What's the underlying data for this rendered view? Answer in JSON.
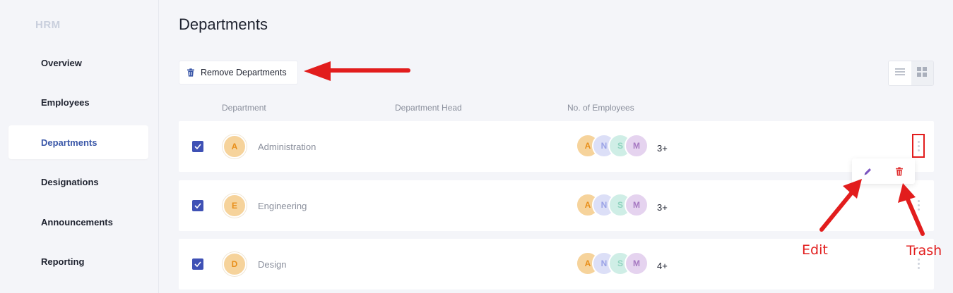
{
  "sidebar": {
    "brand": "HRM",
    "items": [
      {
        "label": "Overview"
      },
      {
        "label": "Employees"
      },
      {
        "label": "Departments",
        "active": true
      },
      {
        "label": "Designations"
      },
      {
        "label": "Announcements"
      },
      {
        "label": "Reporting"
      }
    ]
  },
  "main": {
    "title": "Departments",
    "remove_label": "Remove Departments",
    "columns": {
      "department": "Department",
      "head": "Department Head",
      "employees": "No. of Employees"
    },
    "rows": [
      {
        "initial": "A",
        "name": "Administration",
        "count": "3+"
      },
      {
        "initial": "E",
        "name": "Engineering",
        "count": "3+"
      },
      {
        "initial": "D",
        "name": "Design",
        "count": "4+"
      }
    ],
    "avatar_initials": [
      "A",
      "N",
      "S",
      "M"
    ]
  },
  "annotations": {
    "edit": "Edit",
    "trash": "Trash"
  },
  "colors": {
    "accent": "#3a57a8",
    "checkbox": "#3f51b5",
    "annotation": "#e21d1d",
    "trash": "#e03131",
    "edit": "#7e57c2"
  }
}
